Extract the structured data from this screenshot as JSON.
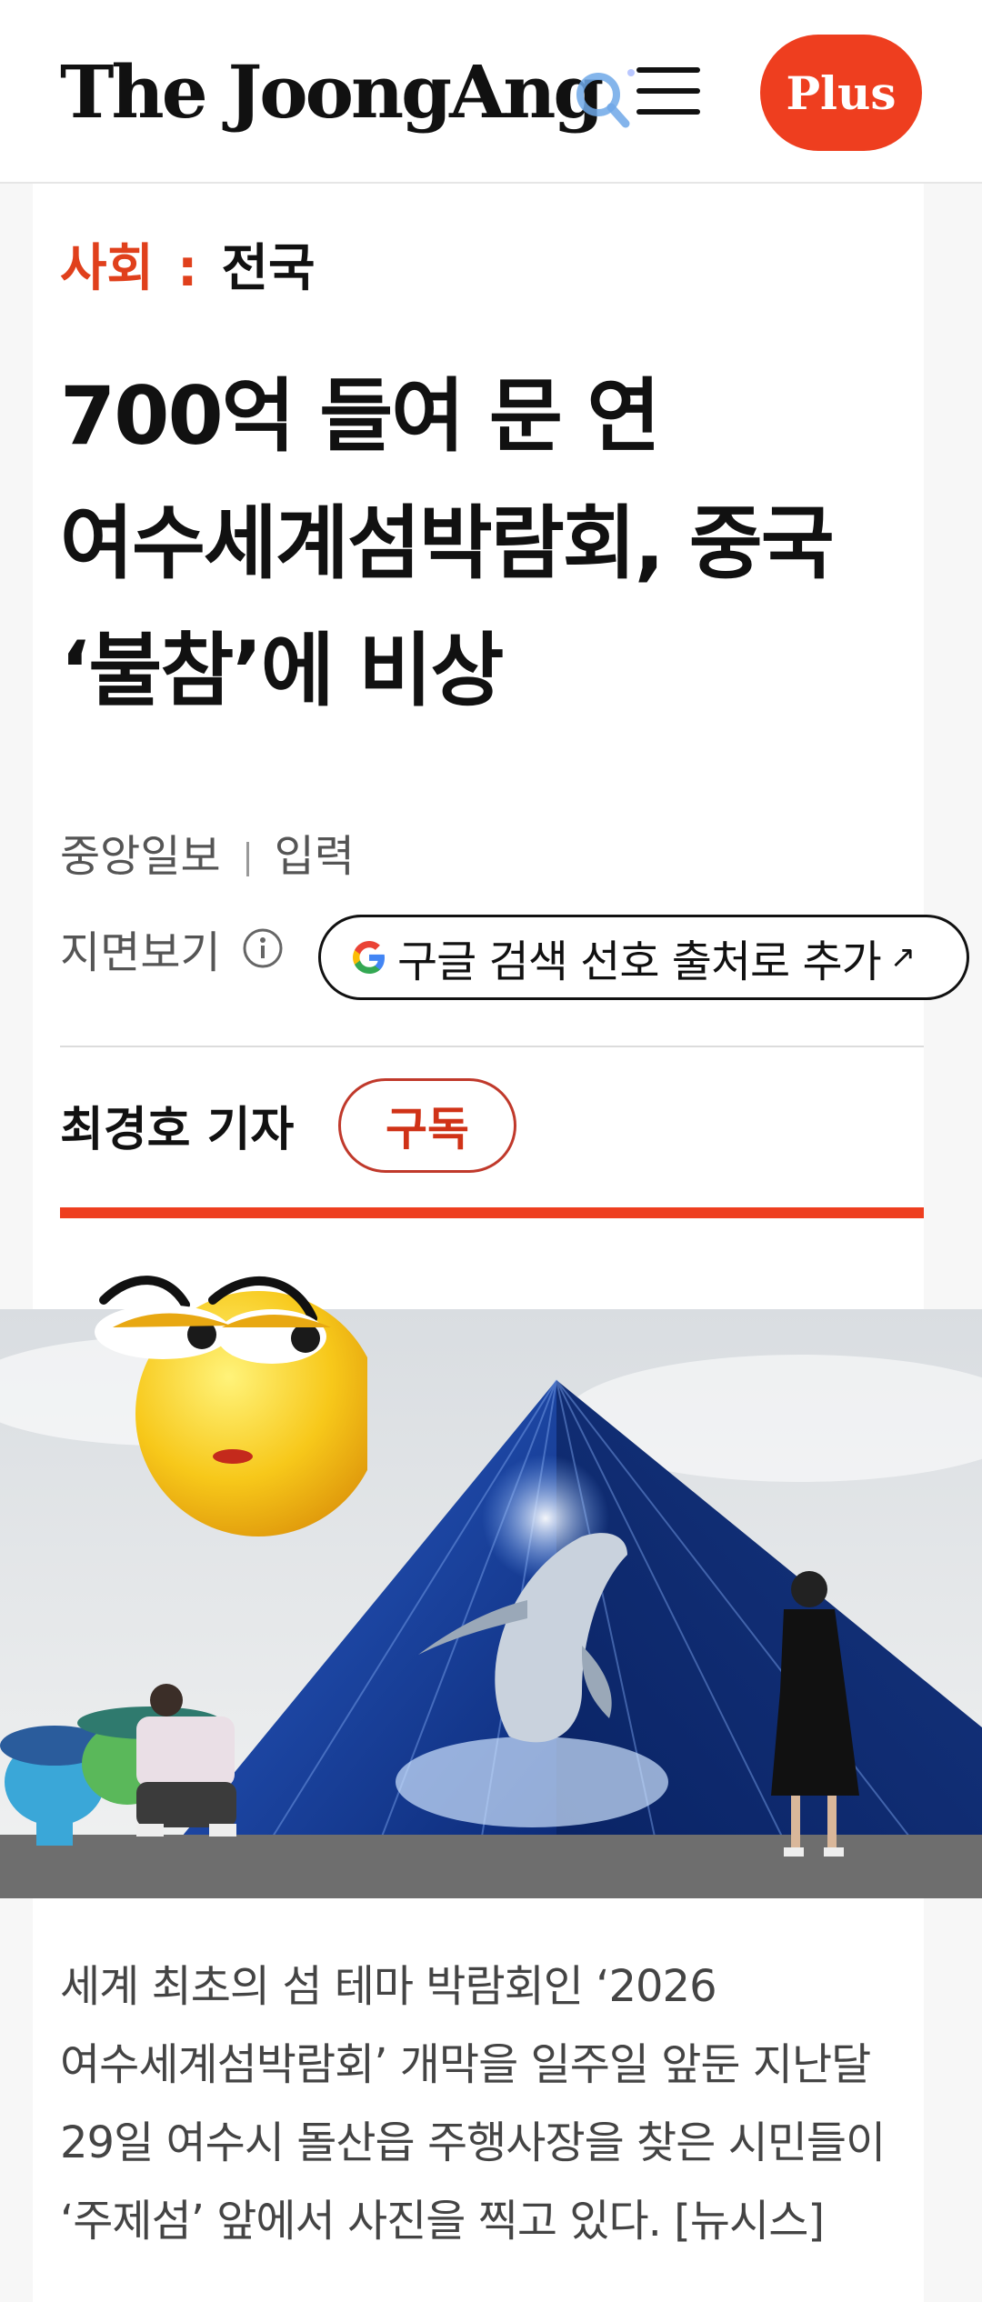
{
  "header": {
    "logo_text": "The JoongAng",
    "menu_icon": "hamburger-menu-icon",
    "plus_label": "Plus",
    "accent_color": "#ee3e1f"
  },
  "article": {
    "section": "사회",
    "separator": ":",
    "subsection": "전국",
    "headline_lines": [
      "700억 들여 문 연",
      "여수세계섬박람회, 중국",
      "‘불참’에 비상"
    ],
    "source": "중앙일보",
    "input_label": "입력",
    "paper_view_label": "지면보기",
    "google_button_label": "구글 검색 선호 출처로 추가",
    "author": "최경호 기자",
    "subscribe_label": "구독",
    "caption_lines": [
      "세계 최초의 섬 테마 박람회인 ‘2026",
      "여수세계섬박람회’ 개막을 일주일 앞둔 지난달",
      "29일 여수시 돌산읍 주행사장을 찾은 시민들이",
      "‘주제섬’ 앞에서 사진을 찍고 있다. [뉴시스]"
    ]
  }
}
